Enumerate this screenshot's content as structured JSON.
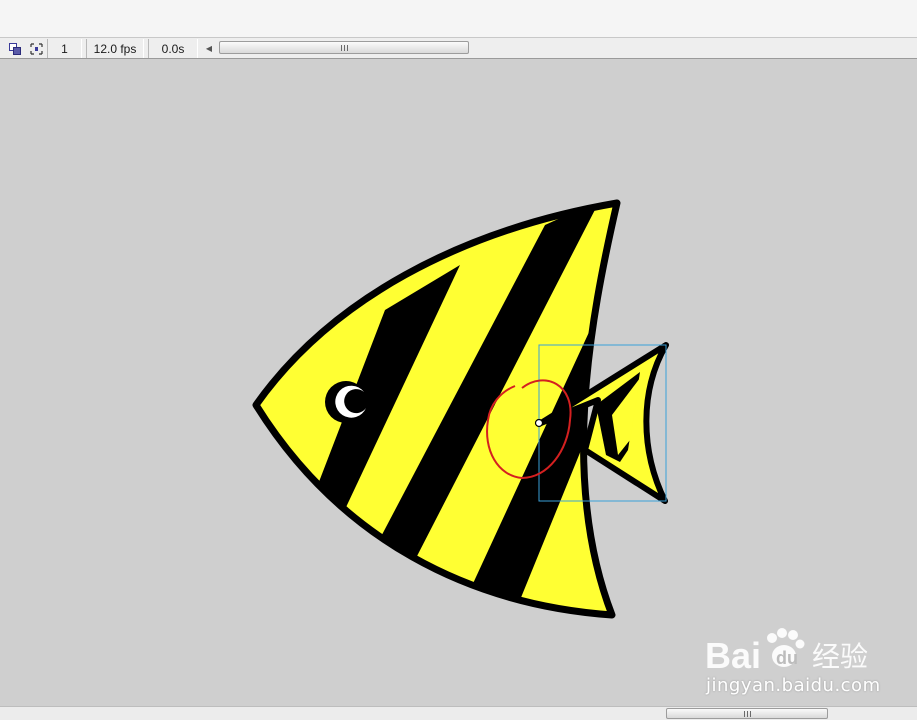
{
  "timeline": {
    "current_frame": "1",
    "frame_rate": "12.0 fps",
    "elapsed_time": "0.0s"
  },
  "icons": {
    "onion_skin": "onion-skin-icon",
    "center_frame": "center-frame-icon",
    "scroll_left": "scroll-left-arrow-icon"
  },
  "stage": {
    "background_color": "#cfcfcf",
    "fish_body_color": "#ffff33",
    "fish_stripe_color": "#000000",
    "selection_box_color": "#3aa0d8",
    "annotation_circle_color": "#d42020"
  },
  "watermark": {
    "logo_text": "Bai",
    "logo_text_2": "du",
    "logo_chinese": "经验",
    "url": "jingyan.baidu.com"
  }
}
